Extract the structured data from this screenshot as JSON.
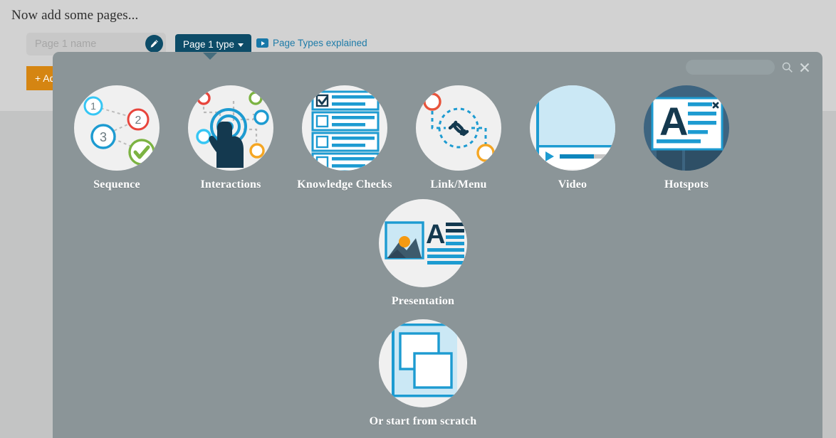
{
  "page": {
    "heading": "Now add some pages...",
    "background_color": "#d2d2d2"
  },
  "toolbar": {
    "name_input_placeholder": "Page 1 name",
    "name_input_value": "",
    "edit_icon": "pencil-icon",
    "type_button_label": "Page 1 type",
    "type_button_color": "#0d4c68",
    "explained_link": "Page Types explained",
    "explained_icon": "video-icon",
    "explained_color": "#1d7ba8",
    "add_button_label": "+ Add Page",
    "add_button_color": "#d58512"
  },
  "overlay": {
    "background_color": "#8b9598",
    "search": {
      "placeholder": "",
      "value": "",
      "search_icon": "search-icon",
      "close_icon": "close-icon"
    },
    "tiles": [
      {
        "id": "sequence",
        "label": "Sequence",
        "icon": "sequence-icon"
      },
      {
        "id": "interactions",
        "label": "Interactions",
        "icon": "interactions-icon"
      },
      {
        "id": "knowledge",
        "label": "Knowledge Checks",
        "icon": "knowledge-checks-icon"
      },
      {
        "id": "linkmenu",
        "label": "Link/Menu",
        "icon": "link-menu-icon"
      },
      {
        "id": "video",
        "label": "Video",
        "icon": "video-page-icon"
      },
      {
        "id": "hotspots",
        "label": "Hotspots",
        "icon": "hotspots-icon"
      },
      {
        "id": "presentation",
        "label": "Presentation",
        "icon": "presentation-icon"
      },
      {
        "id": "scratch",
        "label": "Or start from scratch",
        "icon": "blank-canvas-icon"
      }
    ],
    "palette": {
      "accent_blue": "#1d9bd1",
      "accent_cyan": "#36c6f4",
      "accent_red": "#e8453c",
      "accent_green": "#7cb342",
      "accent_orange": "#f5a623",
      "dark_navy": "#14394f",
      "steel": "#3d6480",
      "light_blue": "#cbe8f5"
    }
  }
}
